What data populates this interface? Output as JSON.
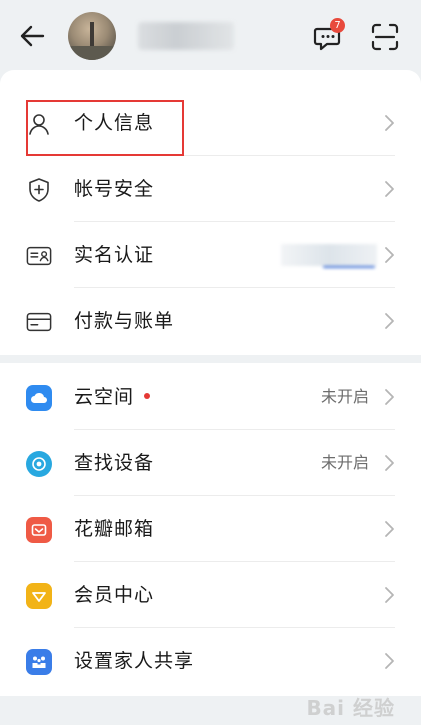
{
  "topbar": {
    "back": "back-icon",
    "message_badge": "7",
    "scan": "scan-icon"
  },
  "section1": [
    {
      "id": "personal-info",
      "label": "个人信息",
      "icon": "person-icon",
      "status": ""
    },
    {
      "id": "account-security",
      "label": "帐号安全",
      "icon": "shield-icon",
      "status": ""
    },
    {
      "id": "real-name",
      "label": "实名认证",
      "icon": "id-card-icon",
      "status": ""
    },
    {
      "id": "payment",
      "label": "付款与账单",
      "icon": "card-icon",
      "status": ""
    }
  ],
  "section2": [
    {
      "id": "cloud",
      "label": "云空间",
      "icon": "cloud-icon",
      "status": "未开启",
      "color": "#2f8bf0"
    },
    {
      "id": "find-device",
      "label": "查找设备",
      "icon": "radar-icon",
      "status": "未开启",
      "color": "#28a8e0"
    },
    {
      "id": "petal-mail",
      "label": "花瓣邮箱",
      "icon": "mail-icon",
      "status": "",
      "color": "#ef5a45"
    },
    {
      "id": "member",
      "label": "会员中心",
      "icon": "member-icon",
      "status": "",
      "color": "#f2b317"
    },
    {
      "id": "family",
      "label": "设置家人共享",
      "icon": "family-icon",
      "status": "",
      "color": "#3a7de8"
    }
  ],
  "watermark": "Bai 经验"
}
